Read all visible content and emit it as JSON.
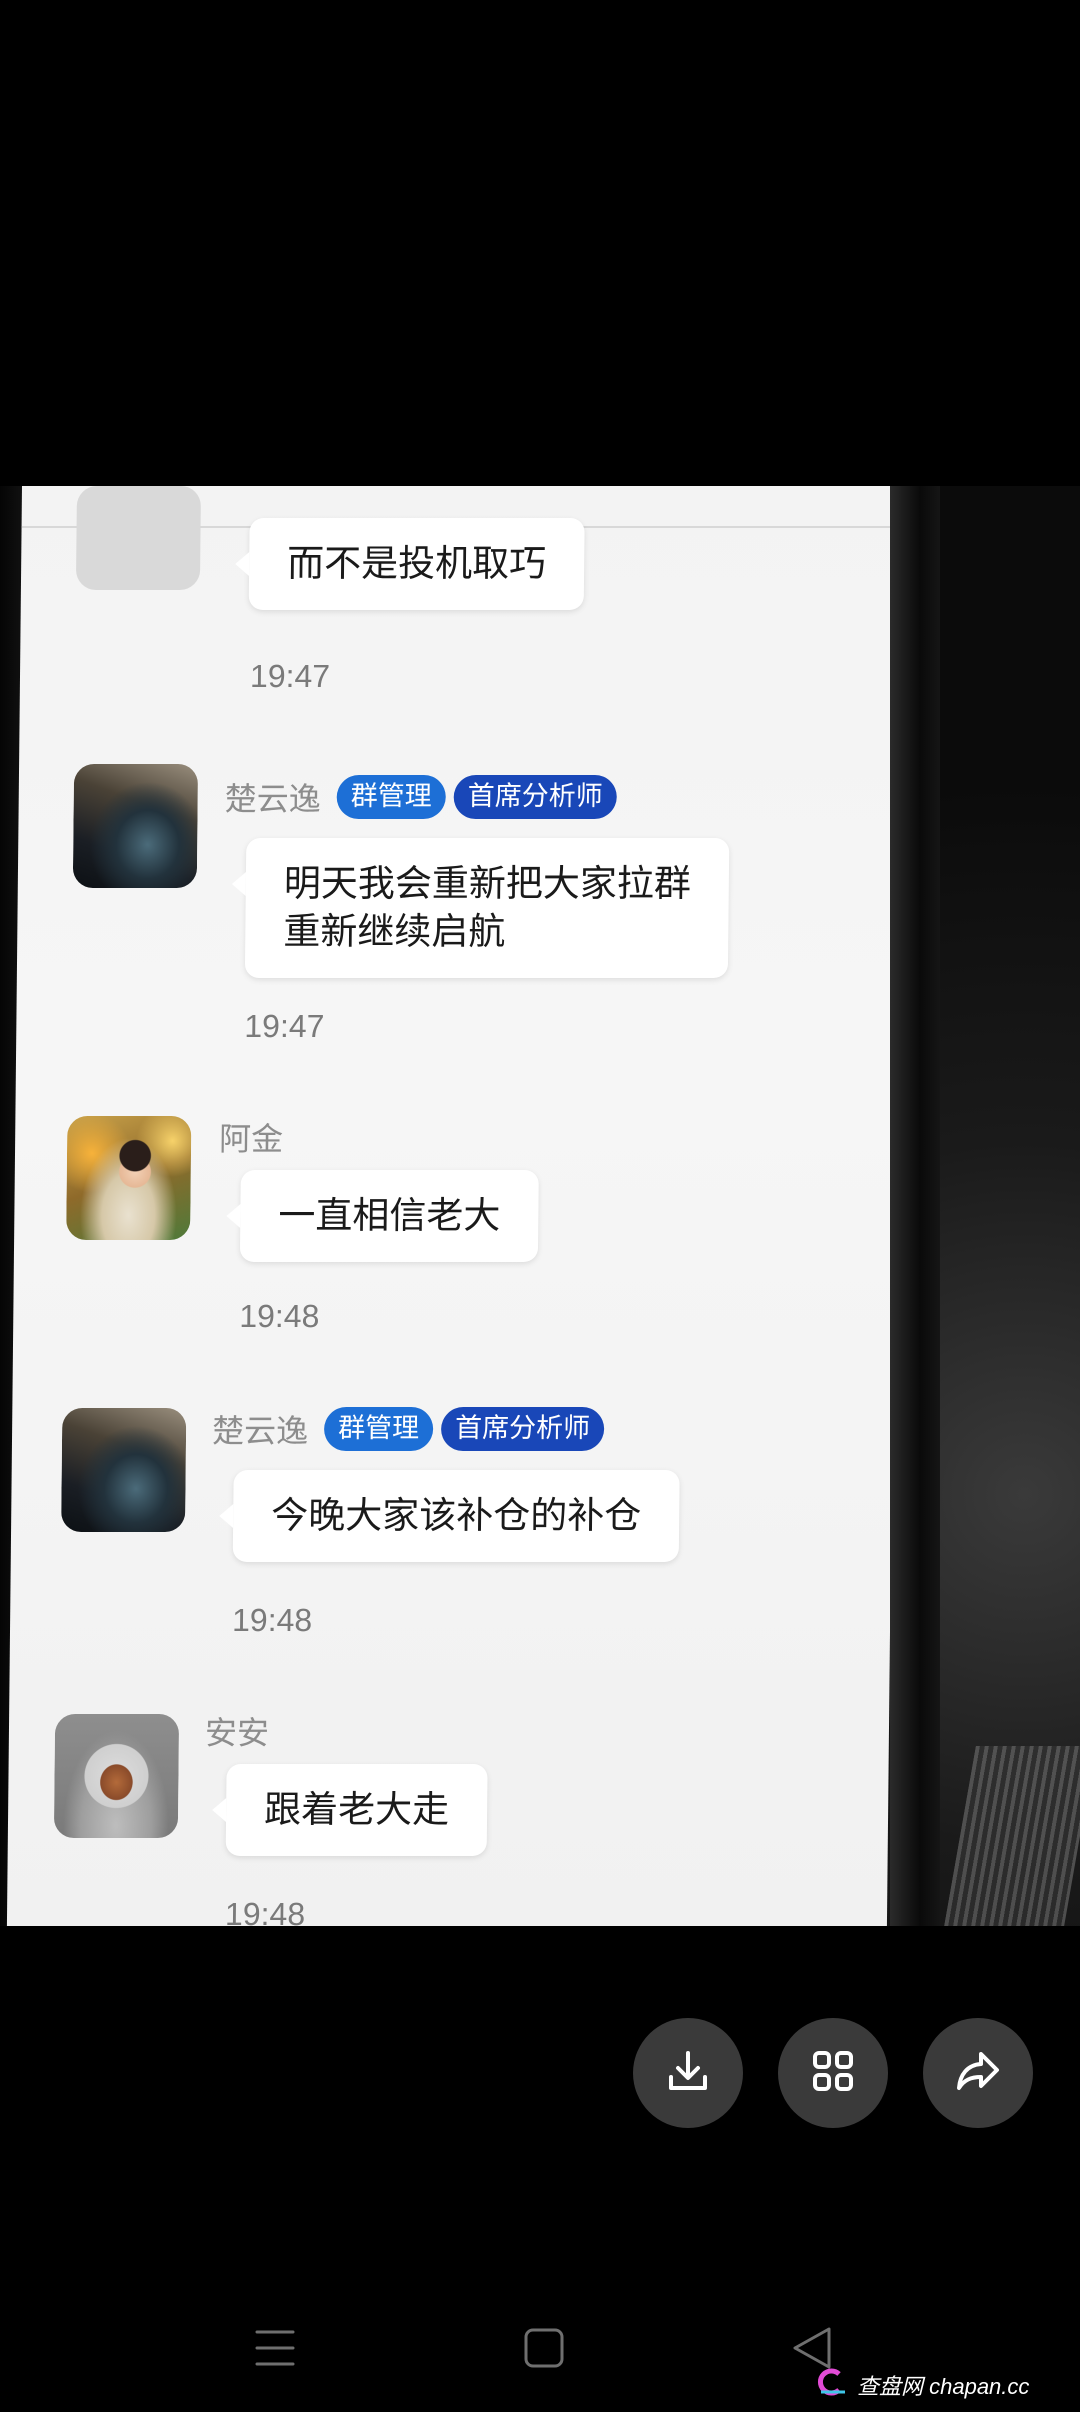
{
  "chat": {
    "messages": [
      {
        "name": "",
        "badges": [],
        "text_lines": [
          "而不是投机取巧"
        ],
        "time": "19:47"
      },
      {
        "name": "楚云逸",
        "badges": [
          "群管理",
          "首席分析师"
        ],
        "text_lines": [
          "明天我会重新把大家拉群",
          "重新继续启航"
        ],
        "time": "19:47"
      },
      {
        "name": "阿金",
        "badges": [],
        "text_lines": [
          "一直相信老大"
        ],
        "time": "19:48"
      },
      {
        "name": "楚云逸",
        "badges": [
          "群管理",
          "首席分析师"
        ],
        "text_lines": [
          "今晚大家该补仓的补仓"
        ],
        "time": "19:48"
      },
      {
        "name": "安安",
        "badges": [],
        "text_lines": [
          "跟着老大走"
        ],
        "time": "19:48"
      }
    ]
  },
  "viewer_actions": {
    "download_icon": "download-icon",
    "grid_icon": "grid-icon",
    "share_icon": "share-icon"
  },
  "system_nav": {
    "menu_icon": "menu-icon",
    "home_icon": "home-icon",
    "back_icon": "back-icon"
  },
  "watermark": {
    "text": "查盘网 chapan.cc"
  },
  "colors": {
    "admin_badge": "#1d6fd6",
    "chief_badge": "#1947b8",
    "bubble": "#ffffff",
    "chat_bg": "#f3f3f3"
  }
}
